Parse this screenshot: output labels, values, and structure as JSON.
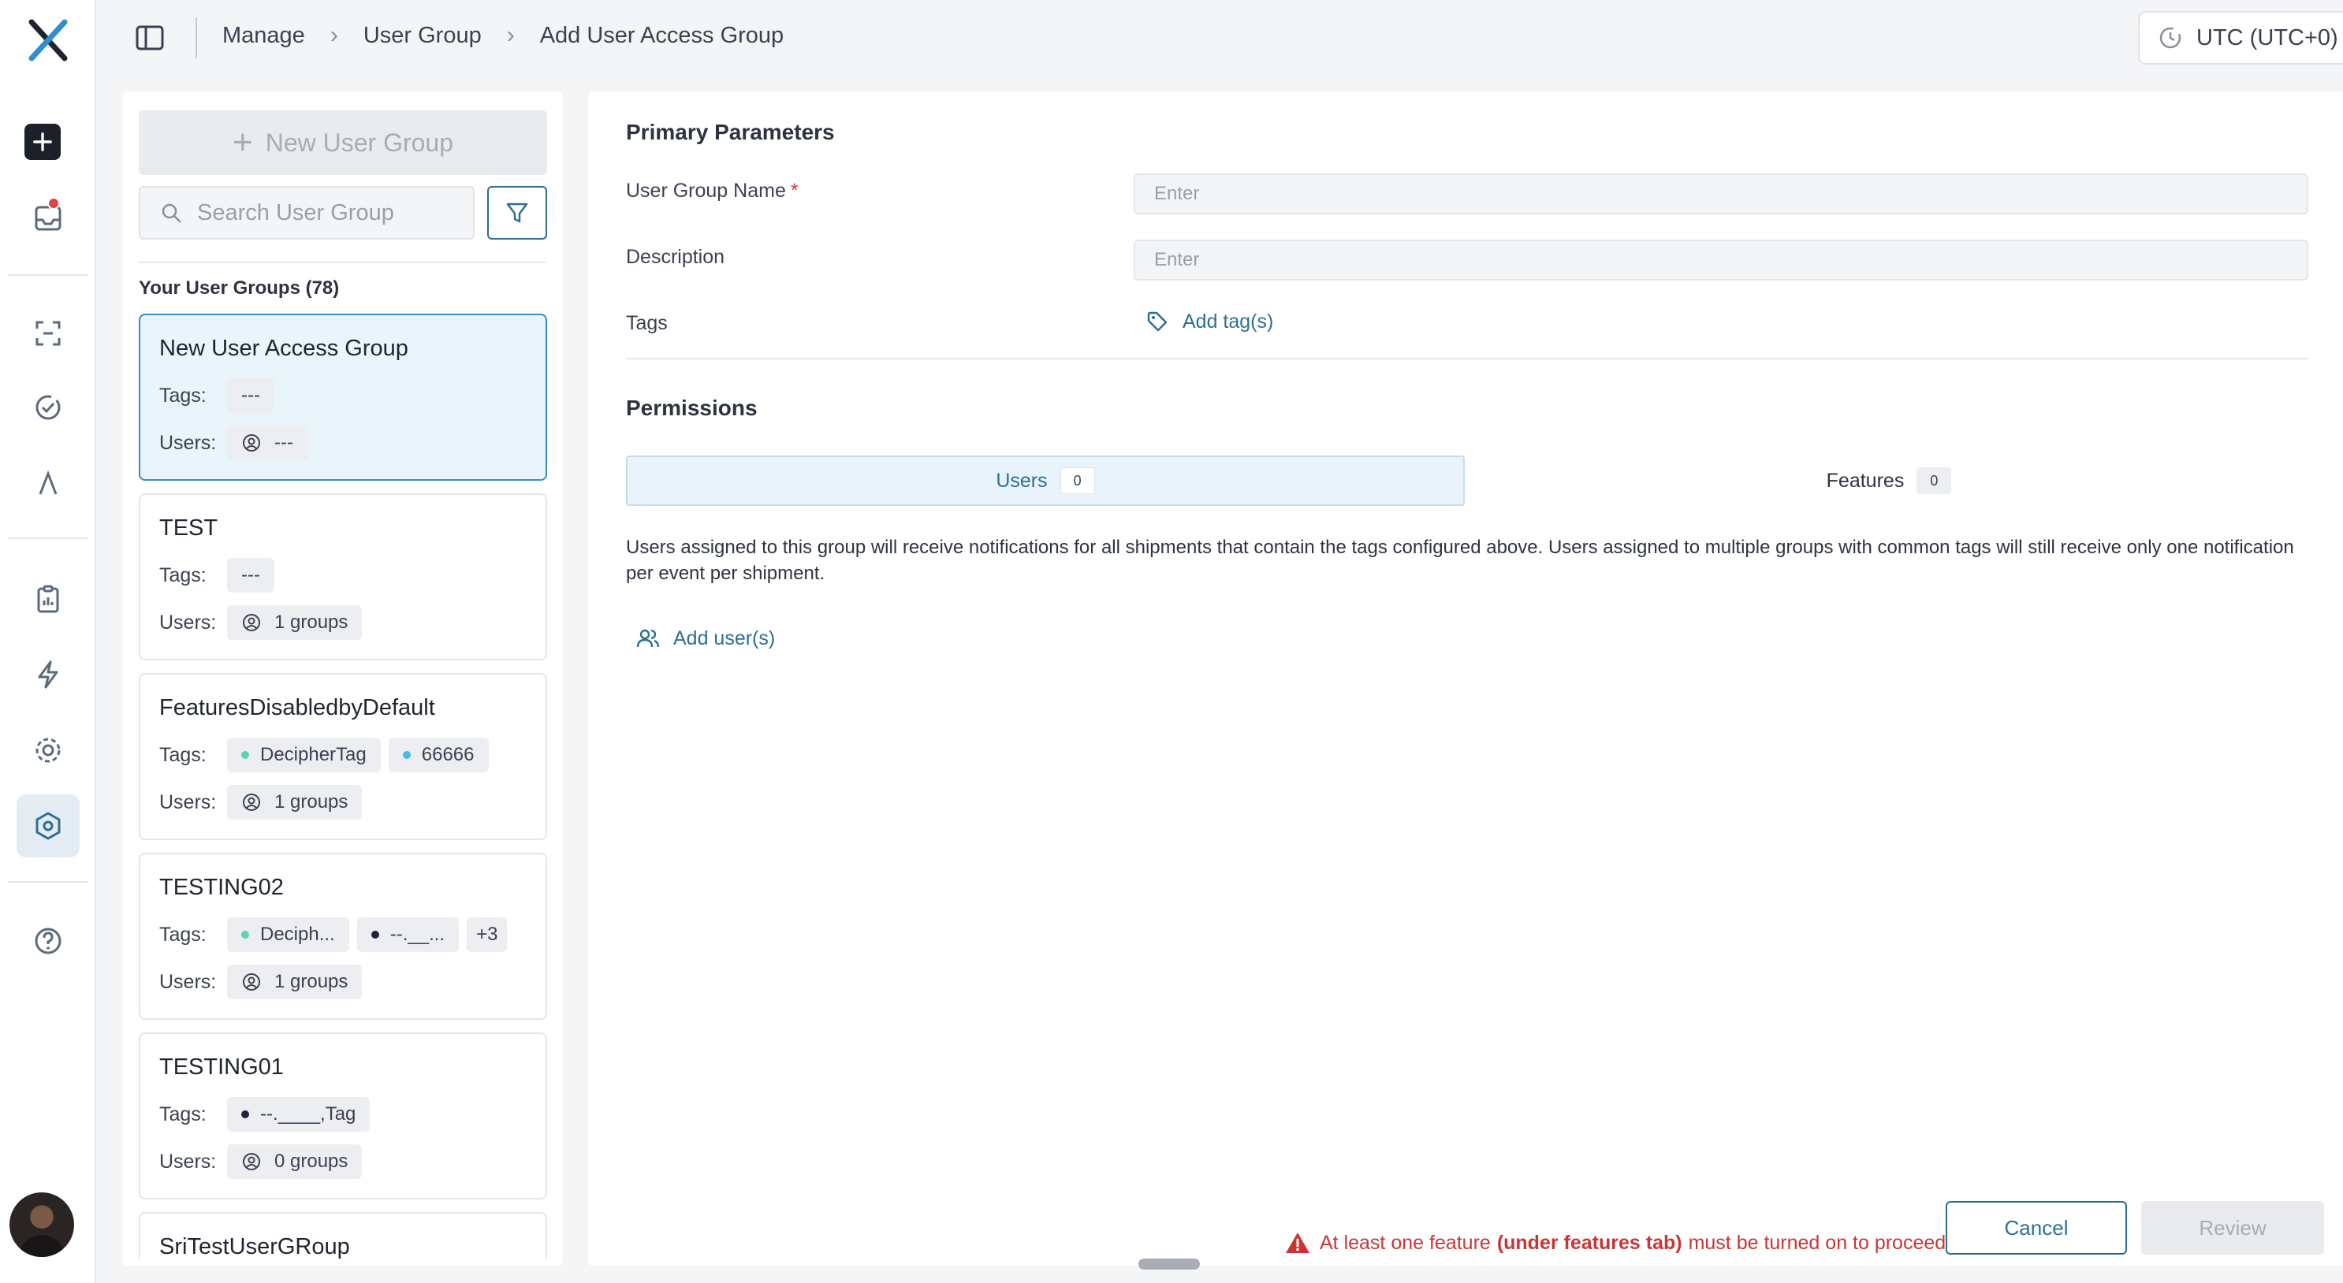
{
  "app": {
    "accent_color": "#2d6f93",
    "warning_color": "#c93535"
  },
  "rail": {
    "icons": [
      "x-logo-icon",
      "plus-icon",
      "inbox-icon",
      "scan-icon",
      "check-circle-icon",
      "lambda-icon",
      "clipboard-icon",
      "bolt-icon",
      "gear-icon",
      "hexagon-settings-icon",
      "help-icon",
      "avatar"
    ],
    "active": "hexagon-settings-icon"
  },
  "header": {
    "breadcrumb": [
      "Manage",
      "User Group",
      "Add User Access Group"
    ],
    "timezone": "UTC (UTC+0)"
  },
  "list": {
    "new_button": "New User Group",
    "search_placeholder": "Search User Group",
    "title": "Your User Groups (78)",
    "tags_label": "Tags:",
    "users_label": "Users:",
    "cards": [
      {
        "name": "New User Access Group",
        "tags": [
          "---"
        ],
        "users": "---",
        "selected": true
      },
      {
        "name": "TEST",
        "tags": [
          "---"
        ],
        "users": "1 groups"
      },
      {
        "name": "FeaturesDisabledbyDefault",
        "tags": [
          "DecipherTag",
          "66666"
        ],
        "users": "1 groups"
      },
      {
        "name": "TESTING02",
        "tags": [
          "Deciph...",
          "--.__...",
          "+3"
        ],
        "users": "1 groups"
      },
      {
        "name": "TESTING01",
        "tags": [
          "--.____,Tag"
        ],
        "users": "0 groups"
      },
      {
        "name": "SriTestUserGRoup"
      }
    ]
  },
  "form": {
    "primary_title": "Primary Parameters",
    "name_label": "User Group Name",
    "name_required": "*",
    "name_placeholder": "Enter",
    "desc_label": "Description",
    "desc_placeholder": "Enter",
    "tags_label": "Tags",
    "add_tags": "Add tag(s)",
    "permissions_title": "Permissions",
    "tabs": [
      {
        "label": "Users",
        "count": "0"
      },
      {
        "label": "Features",
        "count": "0"
      }
    ],
    "info_text": "Users assigned to this group will receive notifications for all shipments that contain the tags configured above. Users assigned to multiple groups with common tags will still receive only one notification per event per shipment.",
    "add_users": "Add user(s)"
  },
  "footer": {
    "warning_pre": "At least one feature",
    "warning_bold": "(under features tab)",
    "warning_post": "must be turned on to proceed.",
    "cancel": "Cancel",
    "review": "Review"
  }
}
